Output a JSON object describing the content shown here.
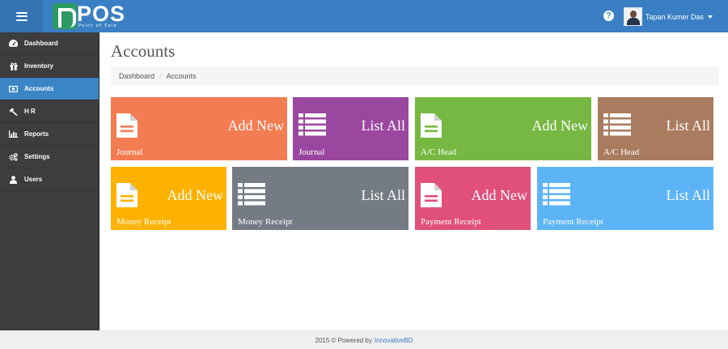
{
  "header": {
    "logo_text": "POS",
    "logo_tagline": "Point of Sale",
    "user_name": "Tapan Kumer Das"
  },
  "sidebar": {
    "items": [
      {
        "label": "Dashboard",
        "icon": "dashboard-icon"
      },
      {
        "label": "Inventory",
        "icon": "gift-icon"
      },
      {
        "label": "Accounts",
        "icon": "money-icon",
        "active": true
      },
      {
        "label": "H R",
        "icon": "gavel-icon"
      },
      {
        "label": "Reports",
        "icon": "bar-chart-icon"
      },
      {
        "label": "Settings",
        "icon": "cogs-icon"
      },
      {
        "label": "Users",
        "icon": "user-icon"
      }
    ]
  },
  "page": {
    "title": "Accounts",
    "breadcrumb": [
      "Dashboard",
      "Accounts"
    ]
  },
  "tiles": [
    {
      "action": "Add New",
      "label": "Journal",
      "icon": "file-icon",
      "color": "#f47c53"
    },
    {
      "action": "List All",
      "label": "Journal",
      "icon": "list-icon",
      "color": "#9b479f"
    },
    {
      "action": "Add New",
      "label": "A/C Head",
      "icon": "file-icon",
      "color": "#77b843"
    },
    {
      "action": "List All",
      "label": "A/C Head",
      "icon": "list-icon",
      "color": "#a97b5f"
    },
    {
      "action": "Add New",
      "label": "Money Receipt",
      "icon": "file-icon",
      "color": "#fdb200"
    },
    {
      "action": "List All",
      "label": "Money Receipt",
      "icon": "list-icon",
      "color": "#757b84"
    },
    {
      "action": "Add New",
      "label": "Payment Receipt",
      "icon": "file-icon",
      "color": "#e0507a"
    },
    {
      "action": "List All",
      "label": "Payment Receipt",
      "icon": "list-icon",
      "color": "#5cb4f6"
    }
  ],
  "footer": {
    "text": "2015 © Powered by",
    "link": "InnovativeBD"
  },
  "colors": {
    "header": "#3a7fc3",
    "sidebar": "#3d3d3d",
    "active_nav": "#3b86c6"
  }
}
